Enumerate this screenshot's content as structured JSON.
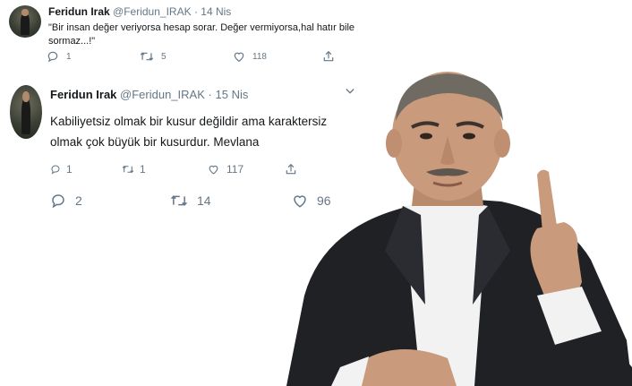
{
  "tweet1": {
    "name": "Feridun Irak",
    "handle": "@Feridun_IRAK",
    "separator": "·",
    "date": "14 Nis",
    "text": "\"Bir insan değer veriyorsa hesap sorar. Değer vermiyorsa,hal hatır bile sormaz...!\"",
    "replies": "1",
    "retweets": "5",
    "likes": "118"
  },
  "tweet2": {
    "name": "Feridun Irak",
    "handle": "@Feridun_IRAK",
    "separator": "·",
    "date": "15 Nis",
    "text": "Kabiliyetsiz olmak bir kusur değildir ama karaktersiz olmak çok büyük bir kusurdur. Mevlana",
    "replies": "1",
    "retweets": "1",
    "likes": "117",
    "replies_lower": "2",
    "retweets_lower": "14",
    "likes_lower": "96"
  },
  "icons": [
    "reply-icon",
    "retweet-icon",
    "like-icon",
    "share-icon",
    "chevron-down-icon"
  ],
  "colors": {
    "meta": "#657786",
    "text": "#14171a",
    "suit": "#1f2125",
    "shirt": "#f2f2f2",
    "skin": "#c99a7c"
  }
}
